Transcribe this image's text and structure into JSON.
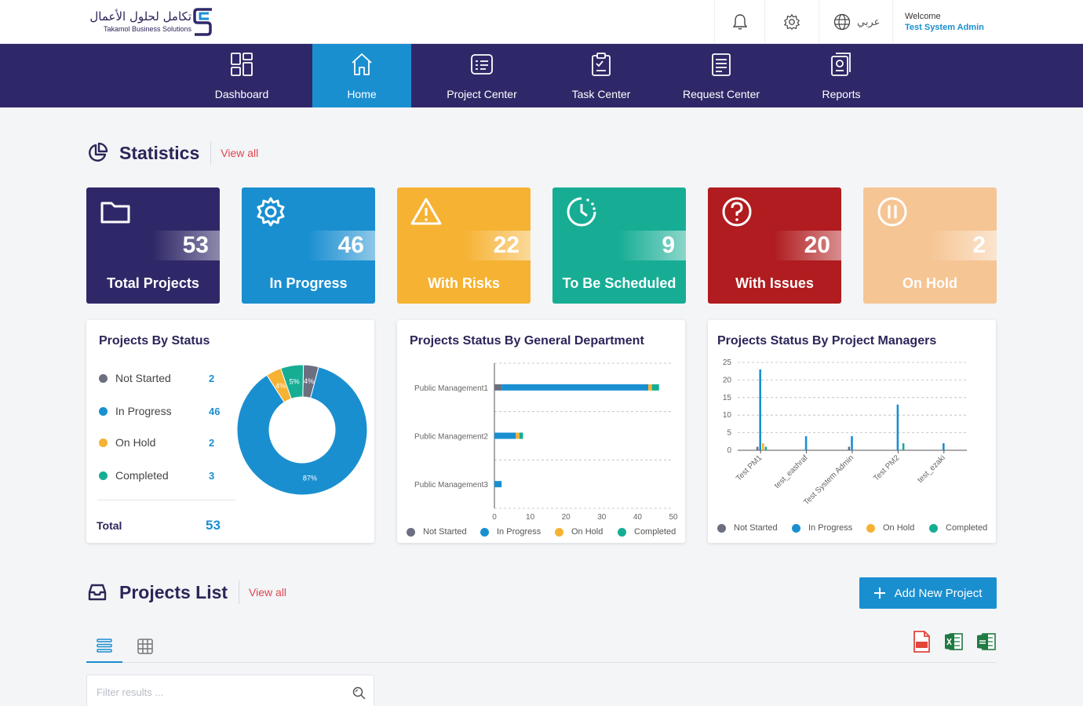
{
  "brand": {
    "name_ar": "تكامل لحلول الأعمال",
    "name_en": "Takamol Business Solutions"
  },
  "header": {
    "language_label": "عربي",
    "welcome_label": "Welcome",
    "user_name": "Test System Admin"
  },
  "nav": {
    "items": [
      {
        "label": "Dashboard",
        "icon": "dashboard-icon"
      },
      {
        "label": "Home",
        "icon": "home-icon",
        "active": true
      },
      {
        "label": "Project Center",
        "icon": "project-center-icon"
      },
      {
        "label": "Task Center",
        "icon": "task-center-icon"
      },
      {
        "label": "Request Center",
        "icon": "request-center-icon"
      },
      {
        "label": "Reports",
        "icon": "reports-icon"
      }
    ]
  },
  "statistics": {
    "title": "Statistics",
    "view_all": "View all",
    "cards": [
      {
        "label": "Total Projects",
        "value": "53",
        "color": "#2f2868",
        "icon": "folder-icon"
      },
      {
        "label": "In Progress",
        "value": "46",
        "color": "#1a8fd0",
        "icon": "gear-icon"
      },
      {
        "label": "With Risks",
        "value": "22",
        "color": "#f6b233",
        "icon": "warning-icon"
      },
      {
        "label": "To Be Scheduled",
        "value": "9",
        "color": "#17ad95",
        "icon": "clock-icon"
      },
      {
        "label": "With Issues",
        "value": "20",
        "color": "#b01c1f",
        "icon": "question-icon"
      },
      {
        "label": "On Hold",
        "value": "2",
        "color": "#f6c594",
        "icon": "pause-icon"
      }
    ]
  },
  "colors": {
    "not_started": "#6b6f80",
    "in_progress": "#1a8fd0",
    "on_hold": "#f6b233",
    "completed": "#17ad95",
    "accent": "#1a8fd0",
    "brand": "#2f2868",
    "link": "#e2454f"
  },
  "projects_by_status": {
    "title": "Projects By Status",
    "rows": [
      {
        "label": "Not Started",
        "count": "2"
      },
      {
        "label": "In Progress",
        "count": "46"
      },
      {
        "label": "On Hold",
        "count": "2"
      },
      {
        "label": "Completed",
        "count": "3"
      }
    ],
    "total_label": "Total",
    "total_value": "53"
  },
  "legend": {
    "not_started": "Not Started",
    "in_progress": "In Progress",
    "on_hold": "On Hold",
    "completed": "Completed"
  },
  "chart_data": [
    {
      "type": "pie",
      "title": "Projects By Status",
      "categories": [
        "Not Started",
        "In Progress",
        "On Hold",
        "Completed"
      ],
      "values": [
        2,
        46,
        2,
        3
      ],
      "labels": [
        "4%",
        "87%",
        "4%",
        "5%"
      ]
    },
    {
      "type": "bar",
      "title": "Projects Status By General Department",
      "orientation": "horizontal",
      "stacked": true,
      "categories": [
        "Public Management1",
        "Public Management2",
        "Public Management3"
      ],
      "series": [
        {
          "name": "Not Started",
          "values": [
            2,
            0,
            0
          ]
        },
        {
          "name": "In Progress",
          "values": [
            41,
            6,
            2
          ]
        },
        {
          "name": "On Hold",
          "values": [
            1,
            1,
            0
          ]
        },
        {
          "name": "Completed",
          "values": [
            2,
            1,
            0
          ]
        }
      ],
      "xlim": [
        0,
        50
      ],
      "xticks": [
        0,
        10,
        20,
        30,
        40,
        50
      ],
      "grid": true,
      "legend": "bottom"
    },
    {
      "type": "bar",
      "title": "Projects Status By Project Managers",
      "categories": [
        "Test PM1",
        "test_eashraf",
        "Test System Admin",
        "Test PM2",
        "test_ezaki"
      ],
      "series": [
        {
          "name": "Not Started",
          "values": [
            1,
            0,
            1,
            0,
            0
          ]
        },
        {
          "name": "In Progress",
          "values": [
            23,
            4,
            4,
            13,
            2
          ]
        },
        {
          "name": "On Hold",
          "values": [
            2,
            0,
            0,
            0,
            0
          ]
        },
        {
          "name": "Completed",
          "values": [
            1,
            0,
            0,
            2,
            0
          ]
        }
      ],
      "ylim": [
        0,
        25
      ],
      "yticks": [
        0,
        5,
        10,
        15,
        20,
        25
      ],
      "grid": true,
      "legend": "bottom"
    }
  ],
  "projects_list": {
    "title": "Projects List",
    "view_all": "View all",
    "add_button": "Add New Project",
    "filter_placeholder": "Filter results ..."
  }
}
